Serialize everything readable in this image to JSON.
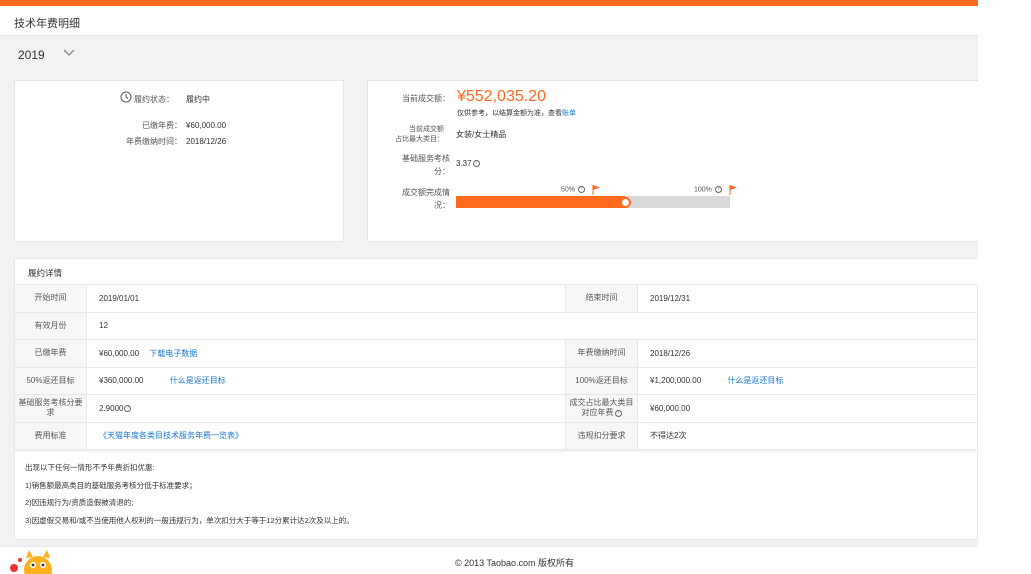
{
  "header": {
    "title": "技术年费明细"
  },
  "year_selector": {
    "value": "2019"
  },
  "status_card": {
    "status_label": "履约状态：",
    "status_value": "履约中",
    "paid_fee_label": "已缴年费：",
    "paid_fee_value": "¥60,000.00",
    "paid_time_label": "年费缴纳时间：",
    "paid_time_value": "2018/12/26"
  },
  "deal_card": {
    "amount_label": "当前成交额：",
    "amount_value": "¥552,035.20",
    "amount_note": "仅供参考，以结算金额为准，查看",
    "amount_note_link": "账单",
    "category_label_line1": "当前成交额",
    "category_label_line2": "占比最大类目：",
    "category_value": "女装/女士精品",
    "score_label_line1": "基础服务考核",
    "score_label_line2": "分：",
    "score_value": "3.37",
    "progress_label_line1": "成交额完成情",
    "progress_label_line2": "况：",
    "mark_50": "50%",
    "mark_100": "100%",
    "progress_fraction": 0.615
  },
  "details": {
    "title": "履约详情",
    "start_label": "开始时间",
    "start_value": "2019/01/01",
    "end_label": "结束时间",
    "end_value": "2019/12/31",
    "months_label": "有效月份",
    "months_value": "12",
    "paid_label": "已缴年费",
    "paid_value": "¥60,000.00",
    "download_link": "下载电子数据",
    "paid_time_label": "年费缴纳时间",
    "paid_time_value": "2018/12/26",
    "target50_label": "50%返还目标",
    "target50_value": "¥360,000.00",
    "target50_link": "什么是返还目标",
    "target100_label": "100%返还目标",
    "target100_value": "¥1,200,000.00",
    "target100_link": "什么是返还目标",
    "score_req_label": "基础服务考核分要求",
    "score_req_value": "2.9000",
    "cat_fee_label": "成交占比最大类目对应年费",
    "cat_fee_value": "¥60,000.00",
    "standard_label": "费用标准",
    "standard_link": "《天猫年度各类目技术服务年费一览表》",
    "violation_label": "违规扣分要求",
    "violation_value": "不得达2次"
  },
  "notes": {
    "line0": "出现以下任何一情形不予年费折扣优惠:",
    "line1": "1)销售额最高类目的基础服务考核分低于标准要求；",
    "line2": "2)因违规行为/资质造假被清退的;",
    "line3": "3)因虚假交易和/或不当使用他人权利的一般违规行为，单次扣分大于等于12分累计达2次及以上的。"
  },
  "footer": {
    "copyright": "© 2013 Taobao.com 版权所有"
  },
  "colors": {
    "accent": "#ff6a1f",
    "link": "#1a77d2"
  },
  "icons": [
    "clock-icon",
    "chevron-down-icon",
    "question-icon",
    "flag-icon",
    "mascot-icon"
  ]
}
